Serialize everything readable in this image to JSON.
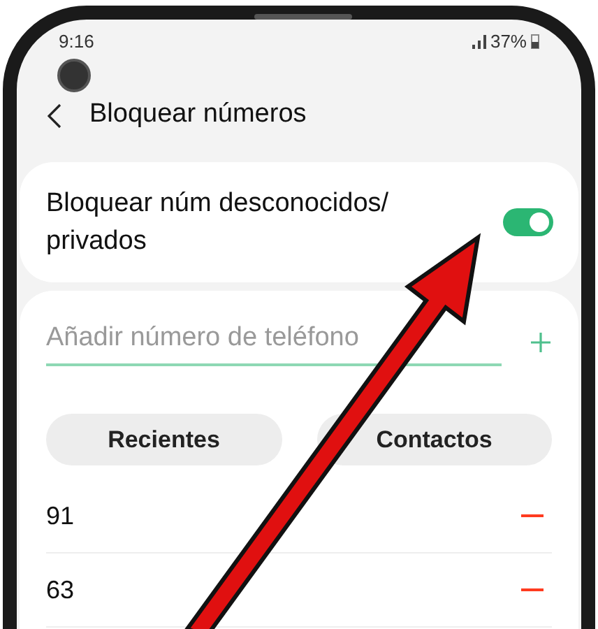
{
  "status_bar": {
    "time": "9:16",
    "battery": "37%"
  },
  "header": {
    "title": "Bloquear números"
  },
  "block_unknown": {
    "label": "Bloquear núm desconocidos/ privados",
    "on": true
  },
  "add_number": {
    "placeholder": "Añadir número de teléfono"
  },
  "buttons": [
    "Recientes",
    "Contactos"
  ],
  "blocked_numbers": [
    {
      "number": "91"
    },
    {
      "number": "63"
    }
  ]
}
